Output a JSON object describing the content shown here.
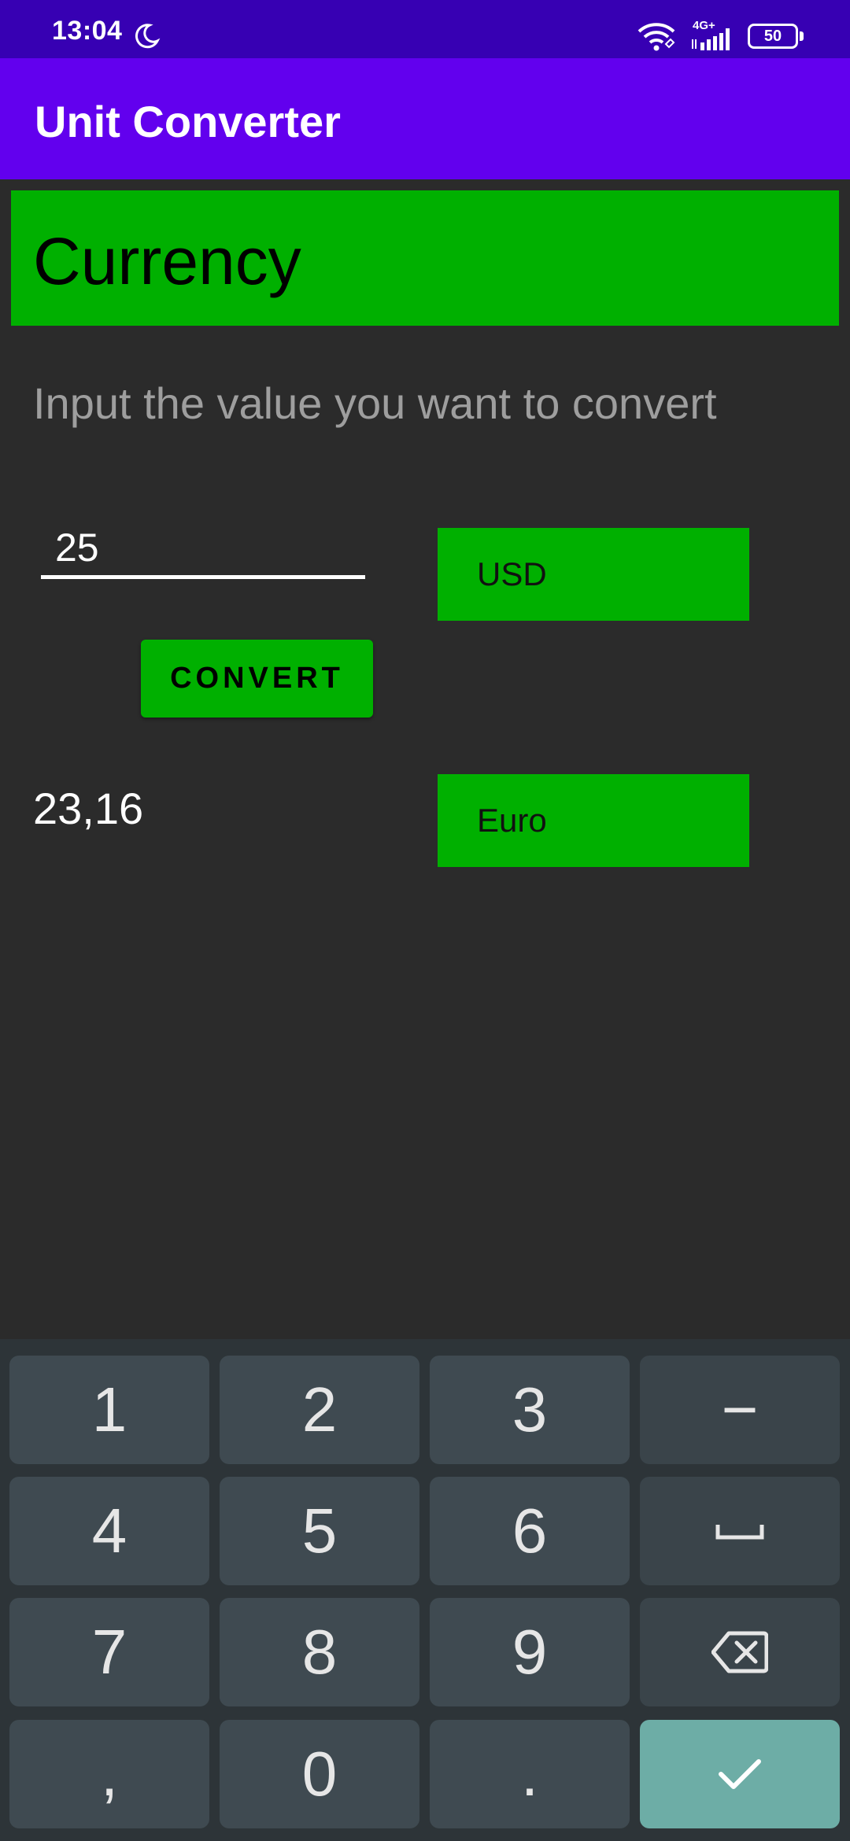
{
  "status_bar": {
    "time": "13:04",
    "network_type": "4G+",
    "battery_level": "50",
    "icons": [
      "moon-icon",
      "wifi-icon",
      "signal-icon",
      "battery-icon"
    ]
  },
  "app_bar": {
    "title": "Unit Converter"
  },
  "category": {
    "label": "Currency"
  },
  "instruction": "Input the value you want to convert",
  "input": {
    "value": "25",
    "from_unit": "USD"
  },
  "convert_button": {
    "label": "CONVERT"
  },
  "result": {
    "value": "23,16",
    "to_unit": "Euro"
  },
  "keyboard": {
    "keys": [
      {
        "label": "1"
      },
      {
        "label": "2"
      },
      {
        "label": "3"
      },
      {
        "label": "−"
      },
      {
        "label": "4"
      },
      {
        "label": "5"
      },
      {
        "label": "6"
      },
      {
        "label": "space",
        "icon": "space-icon"
      },
      {
        "label": "7"
      },
      {
        "label": "8"
      },
      {
        "label": "9"
      },
      {
        "label": "backspace",
        "icon": "backspace-icon"
      },
      {
        "label": ","
      },
      {
        "label": "0"
      },
      {
        "label": "."
      },
      {
        "label": "done",
        "icon": "checkmark-icon"
      }
    ]
  },
  "colors": {
    "status_bar": "#3700b3",
    "app_bar": "#6200ee",
    "accent_green": "#00b000",
    "background": "#2b2b2b",
    "keyboard": "#2d3438",
    "key": "#3f4a51",
    "done_key": "#6dada6"
  }
}
